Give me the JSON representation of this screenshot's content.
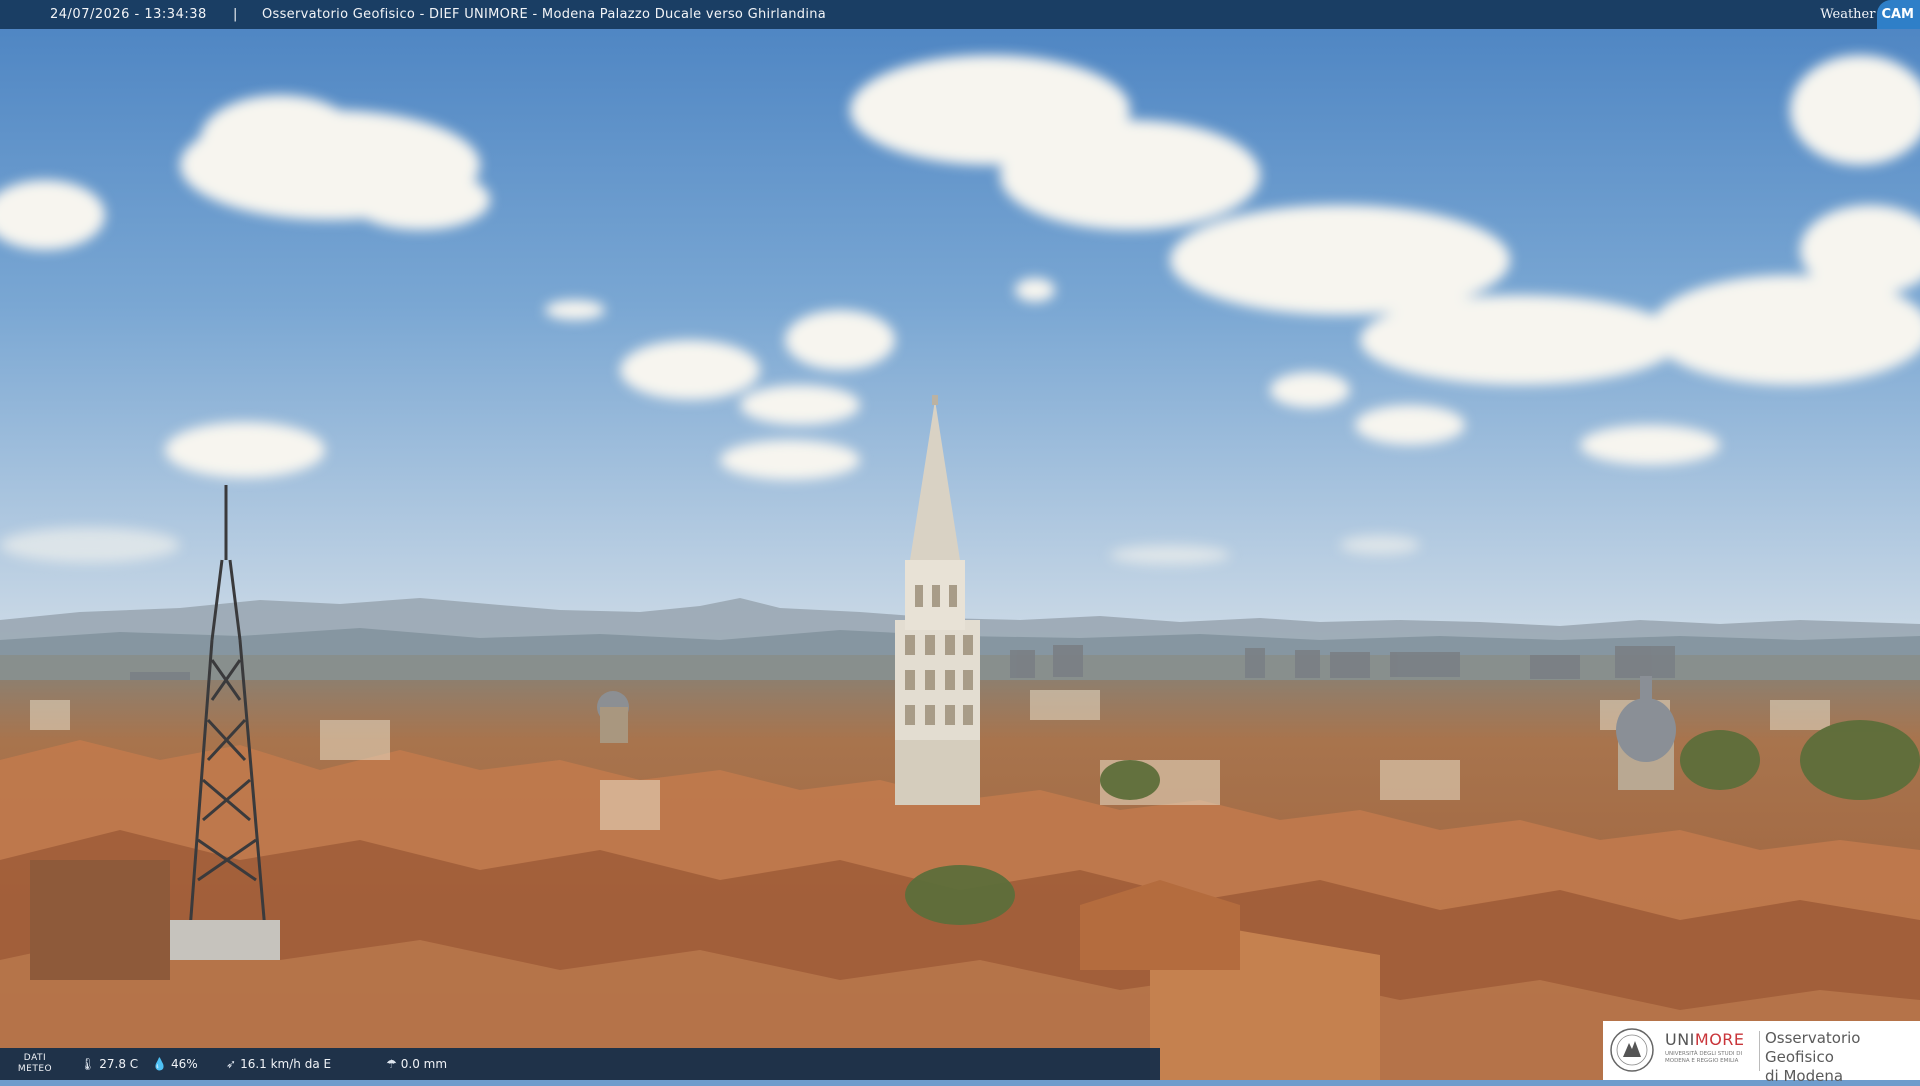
{
  "overlay": {
    "timestamp": "24/07/2026 - 13:34:38",
    "separator": "|",
    "title": "Osservatorio Geofisico - DIEF UNIMORE - Modena Palazzo Ducale verso Ghirlandina",
    "brand_word": "Weather",
    "brand_badge": "CAM"
  },
  "meteo": {
    "label_line1": "DATI",
    "label_line2": "METEO",
    "temperature": "27.8 C",
    "humidity": "46%",
    "wind": "16.1 km/h da E",
    "rain": "0.0 mm",
    "icons": [
      "thermometer-icon",
      "humidity-drop-icon",
      "wind-icon",
      "rain-icon"
    ]
  },
  "logo": {
    "name_prefix": "UNI",
    "name_suffix": "MORE",
    "subtitle": "UNIVERSITÀ DEGLI STUDI DI MODENA E REGGIO EMILIA",
    "obs_line1": "Osservatorio Geofisico",
    "obs_line2": "di Modena"
  },
  "colors": {
    "sky_top": "#4f86c3",
    "sky_horizon": "#c9d9e8",
    "roof": "#b56e45",
    "tower": "#e2ddd2",
    "bar": "#1a3e64",
    "brand_badge": "#2f7fc8",
    "unimore_red": "#c9353a"
  }
}
